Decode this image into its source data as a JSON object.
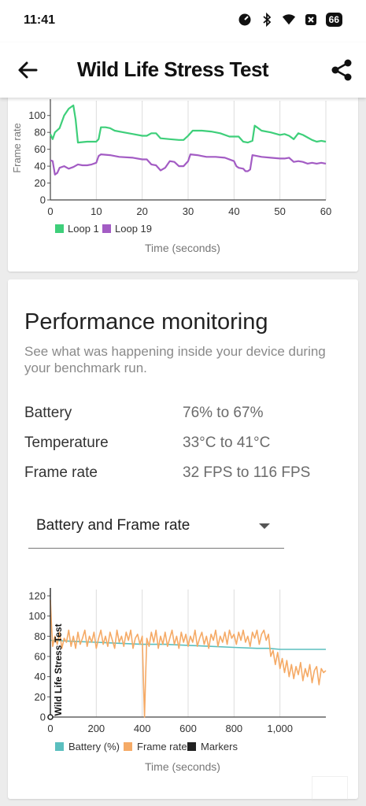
{
  "status_bar": {
    "time": "11:41",
    "battery": "66",
    "icons": [
      "data-saver-icon",
      "bluetooth-icon",
      "wifi-icon",
      "notification-icon",
      "battery-icon"
    ]
  },
  "app_bar": {
    "title": "Wild Life Stress Test",
    "back_icon": "arrow-left-icon",
    "share_icon": "share-icon"
  },
  "colors": {
    "loop1": "#3ecf7a",
    "loop19": "#a35cc4",
    "battery": "#5bbfbf",
    "frame_rate": "#f5aa66",
    "markers": "#222222"
  },
  "performance": {
    "title": "Performance monitoring",
    "description": "See what was happening inside your device during your benchmark run.",
    "stats": [
      {
        "label": "Battery",
        "value": "76% to 67%"
      },
      {
        "label": "Temperature",
        "value": "33°C to 41°C"
      },
      {
        "label": "Frame rate",
        "value": "32 FPS to 116 FPS"
      }
    ],
    "dropdown": {
      "selected": "Battery and Frame rate"
    }
  },
  "chart_data": [
    {
      "type": "line",
      "xlabel": "Time (seconds)",
      "ylabel": "Frame rate",
      "xlim": [
        0,
        60
      ],
      "ylim": [
        0,
        110
      ],
      "x_ticks": [
        0,
        10,
        20,
        30,
        40,
        50,
        60
      ],
      "y_ticks": [
        0,
        20,
        40,
        60,
        80,
        100
      ],
      "x_tick_labels": [
        "0",
        "10",
        "20",
        "30",
        "40",
        "50",
        "60"
      ],
      "y_tick_labels": [
        "0",
        "20",
        "40",
        "60",
        "80",
        "100"
      ],
      "grid": "vertical",
      "legend_position": "bottom-left",
      "series": [
        {
          "name": "Loop 1",
          "color": "#3ecf7a",
          "points": [
            [
              0,
              78
            ],
            [
              0.5,
              72
            ],
            [
              1,
              80
            ],
            [
              2,
              85
            ],
            [
              3,
              100
            ],
            [
              4,
              108
            ],
            [
              5,
              112
            ],
            [
              5.5,
              95
            ],
            [
              6,
              68
            ],
            [
              8,
              69
            ],
            [
              10,
              69
            ],
            [
              10.5,
              72
            ],
            [
              11,
              86
            ],
            [
              12,
              86
            ],
            [
              13,
              85
            ],
            [
              14,
              82
            ],
            [
              16,
              80
            ],
            [
              18,
              78
            ],
            [
              20,
              76
            ],
            [
              21,
              76
            ],
            [
              22,
              79
            ],
            [
              23,
              79
            ],
            [
              24,
              73
            ],
            [
              26,
              72
            ],
            [
              28,
              71
            ],
            [
              29,
              71
            ],
            [
              30,
              76
            ],
            [
              31,
              82
            ],
            [
              33,
              82
            ],
            [
              35,
              81
            ],
            [
              37,
              79
            ],
            [
              39,
              75
            ],
            [
              40,
              75
            ],
            [
              41,
              75
            ],
            [
              42,
              69
            ],
            [
              43,
              68
            ],
            [
              44,
              70
            ],
            [
              44.5,
              88
            ],
            [
              45,
              86
            ],
            [
              46,
              82
            ],
            [
              48,
              80
            ],
            [
              50,
              77
            ],
            [
              51,
              78
            ],
            [
              52,
              76
            ],
            [
              53,
              72
            ],
            [
              54,
              79
            ],
            [
              55,
              77
            ],
            [
              56,
              74
            ],
            [
              57,
              71
            ],
            [
              58,
              69
            ],
            [
              59,
              70
            ],
            [
              60,
              69
            ]
          ]
        },
        {
          "name": "Loop 19",
          "color": "#a35cc4",
          "points": [
            [
              0,
              47
            ],
            [
              0.5,
              46
            ],
            [
              1,
              30
            ],
            [
              1.5,
              32
            ],
            [
              2,
              38
            ],
            [
              3,
              40
            ],
            [
              4,
              37
            ],
            [
              5,
              39
            ],
            [
              6,
              42
            ],
            [
              7,
              41
            ],
            [
              8,
              41
            ],
            [
              9,
              42
            ],
            [
              10,
              44
            ],
            [
              10.5,
              52
            ],
            [
              11,
              54
            ],
            [
              13,
              53
            ],
            [
              15,
              51
            ],
            [
              18,
              50
            ],
            [
              20,
              48
            ],
            [
              21,
              48
            ],
            [
              22,
              42
            ],
            [
              23,
              41
            ],
            [
              24,
              35
            ],
            [
              25,
              38
            ],
            [
              26,
              46
            ],
            [
              27,
              45
            ],
            [
              28,
              40
            ],
            [
              29,
              40
            ],
            [
              30,
              46
            ],
            [
              30.5,
              54
            ],
            [
              32,
              53
            ],
            [
              34,
              51
            ],
            [
              36,
              51
            ],
            [
              38,
              50
            ],
            [
              40,
              46
            ],
            [
              40.5,
              40
            ],
            [
              41,
              38
            ],
            [
              42,
              37
            ],
            [
              42.5,
              34
            ],
            [
              43,
              34
            ],
            [
              43.5,
              36
            ],
            [
              44,
              53
            ],
            [
              46,
              51
            ],
            [
              48,
              50
            ],
            [
              50,
              49
            ],
            [
              51,
              49
            ],
            [
              52,
              50
            ],
            [
              53,
              45
            ],
            [
              54,
              46
            ],
            [
              55,
              45
            ],
            [
              56,
              43
            ],
            [
              57,
              44
            ],
            [
              58,
              43
            ],
            [
              59,
              44
            ],
            [
              60,
              43
            ]
          ]
        }
      ]
    },
    {
      "type": "line",
      "xlabel": "Time (seconds)",
      "xlim": [
        0,
        1200
      ],
      "ylim": [
        0,
        120
      ],
      "x_ticks": [
        0,
        200,
        400,
        600,
        800,
        1000
      ],
      "y_ticks": [
        0,
        20,
        40,
        60,
        80,
        100,
        120
      ],
      "x_tick_labels": [
        "0",
        "200",
        "400",
        "600",
        "800",
        "1,000"
      ],
      "y_tick_labels": [
        "0",
        "20",
        "40",
        "60",
        "80",
        "100",
        "120"
      ],
      "grid": "vertical",
      "legend_position": "bottom-left",
      "marker_label": "Wild Life Stress Test",
      "series": [
        {
          "name": "Battery (%)",
          "color": "#5bbfbf",
          "points": [
            [
              0,
              76
            ],
            [
              100,
              75
            ],
            [
              200,
              74
            ],
            [
              300,
              73
            ],
            [
              400,
              72
            ],
            [
              500,
              72
            ],
            [
              600,
              71
            ],
            [
              700,
              70
            ],
            [
              800,
              69
            ],
            [
              900,
              68
            ],
            [
              950,
              68
            ],
            [
              1000,
              67
            ],
            [
              1100,
              67
            ],
            [
              1200,
              67
            ]
          ]
        },
        {
          "name": "Frame rate",
          "color": "#f5aa66",
          "points": [
            [
              0,
              116
            ],
            [
              5,
              90
            ],
            [
              10,
              70
            ],
            [
              20,
              80
            ],
            [
              30,
              72
            ],
            [
              40,
              84
            ],
            [
              50,
              68
            ],
            [
              60,
              78
            ],
            [
              70,
              74
            ],
            [
              80,
              86
            ],
            [
              90,
              70
            ],
            [
              100,
              80
            ],
            [
              110,
              68
            ],
            [
              120,
              84
            ],
            [
              130,
              72
            ],
            [
              140,
              78
            ],
            [
              150,
              86
            ],
            [
              160,
              70
            ],
            [
              170,
              80
            ],
            [
              180,
              74
            ],
            [
              190,
              84
            ],
            [
              200,
              68
            ],
            [
              210,
              78
            ],
            [
              220,
              86
            ],
            [
              230,
              72
            ],
            [
              240,
              80
            ],
            [
              250,
              70
            ],
            [
              260,
              84
            ],
            [
              270,
              76
            ],
            [
              280,
              68
            ],
            [
              290,
              86
            ],
            [
              300,
              74
            ],
            [
              310,
              80
            ],
            [
              320,
              70
            ],
            [
              330,
              84
            ],
            [
              340,
              76
            ],
            [
              350,
              86
            ],
            [
              360,
              68
            ],
            [
              370,
              78
            ],
            [
              380,
              82
            ],
            [
              390,
              72
            ],
            [
              400,
              80
            ],
            [
              405,
              40
            ],
            [
              410,
              0
            ],
            [
              415,
              40
            ],
            [
              420,
              78
            ],
            [
              430,
              70
            ],
            [
              440,
              84
            ],
            [
              450,
              74
            ],
            [
              460,
              86
            ],
            [
              470,
              68
            ],
            [
              480,
              80
            ],
            [
              490,
              72
            ],
            [
              500,
              84
            ],
            [
              510,
              70
            ],
            [
              520,
              78
            ],
            [
              530,
              86
            ],
            [
              540,
              72
            ],
            [
              550,
              80
            ],
            [
              560,
              68
            ],
            [
              570,
              84
            ],
            [
              580,
              74
            ],
            [
              590,
              82
            ],
            [
              600,
              70
            ],
            [
              610,
              80
            ],
            [
              620,
              74
            ],
            [
              630,
              86
            ],
            [
              640,
              70
            ],
            [
              650,
              78
            ],
            [
              660,
              84
            ],
            [
              670,
              72
            ],
            [
              680,
              80
            ],
            [
              690,
              68
            ],
            [
              700,
              82
            ],
            [
              710,
              76
            ],
            [
              720,
              86
            ],
            [
              730,
              70
            ],
            [
              740,
              80
            ],
            [
              750,
              74
            ],
            [
              760,
              84
            ],
            [
              770,
              72
            ],
            [
              780,
              86
            ],
            [
              790,
              78
            ],
            [
              800,
              82
            ],
            [
              810,
              72
            ],
            [
              820,
              84
            ],
            [
              830,
              76
            ],
            [
              840,
              86
            ],
            [
              850,
              74
            ],
            [
              860,
              80
            ],
            [
              870,
              70
            ],
            [
              880,
              84
            ],
            [
              890,
              78
            ],
            [
              900,
              86
            ],
            [
              910,
              72
            ],
            [
              920,
              82
            ],
            [
              930,
              86
            ],
            [
              940,
              76
            ],
            [
              950,
              82
            ],
            [
              960,
              60
            ],
            [
              970,
              66
            ],
            [
              980,
              52
            ],
            [
              990,
              64
            ],
            [
              1000,
              48
            ],
            [
              1010,
              58
            ],
            [
              1020,
              44
            ],
            [
              1030,
              56
            ],
            [
              1040,
              40
            ],
            [
              1050,
              52
            ],
            [
              1060,
              38
            ],
            [
              1070,
              50
            ],
            [
              1080,
              42
            ],
            [
              1090,
              54
            ],
            [
              1100,
              36
            ],
            [
              1110,
              48
            ],
            [
              1120,
              40
            ],
            [
              1130,
              52
            ],
            [
              1140,
              34
            ],
            [
              1150,
              46
            ],
            [
              1160,
              50
            ],
            [
              1170,
              32
            ],
            [
              1180,
              48
            ],
            [
              1190,
              44
            ],
            [
              1200,
              46
            ]
          ]
        }
      ],
      "markers_legend": "Markers"
    }
  ]
}
